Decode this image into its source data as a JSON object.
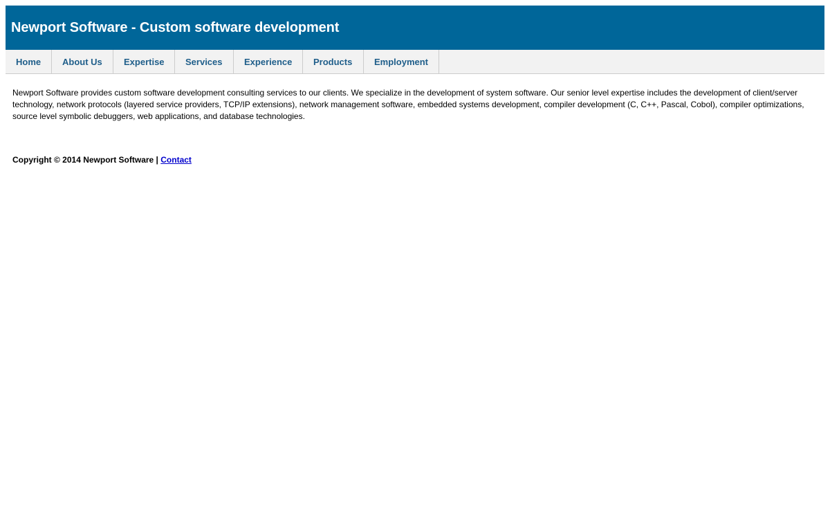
{
  "header": {
    "title": "Newport Software - Custom software development",
    "background_color": "#006699"
  },
  "nav": {
    "items": [
      {
        "label": "Home"
      },
      {
        "label": "About Us"
      },
      {
        "label": "Expertise"
      },
      {
        "label": "Services"
      },
      {
        "label": "Experience"
      },
      {
        "label": "Products"
      },
      {
        "label": "Employment"
      }
    ],
    "link_color": "#1f5e8a"
  },
  "main": {
    "intro": "Newport Software provides custom software development consulting services to our clients. We specialize in the development of system software. Our senior level expertise includes the development of client/server technology, network protocols (layered service providers, TCP/IP extensions), network management software, embedded systems development, compiler development (C, C++, Pascal, Cobol), compiler optimizations, source level symbolic debuggers, web applications, and database technologies."
  },
  "footer": {
    "copyright": "Copyright © 2014 Newport Software | ",
    "contact_label": "Contact"
  }
}
